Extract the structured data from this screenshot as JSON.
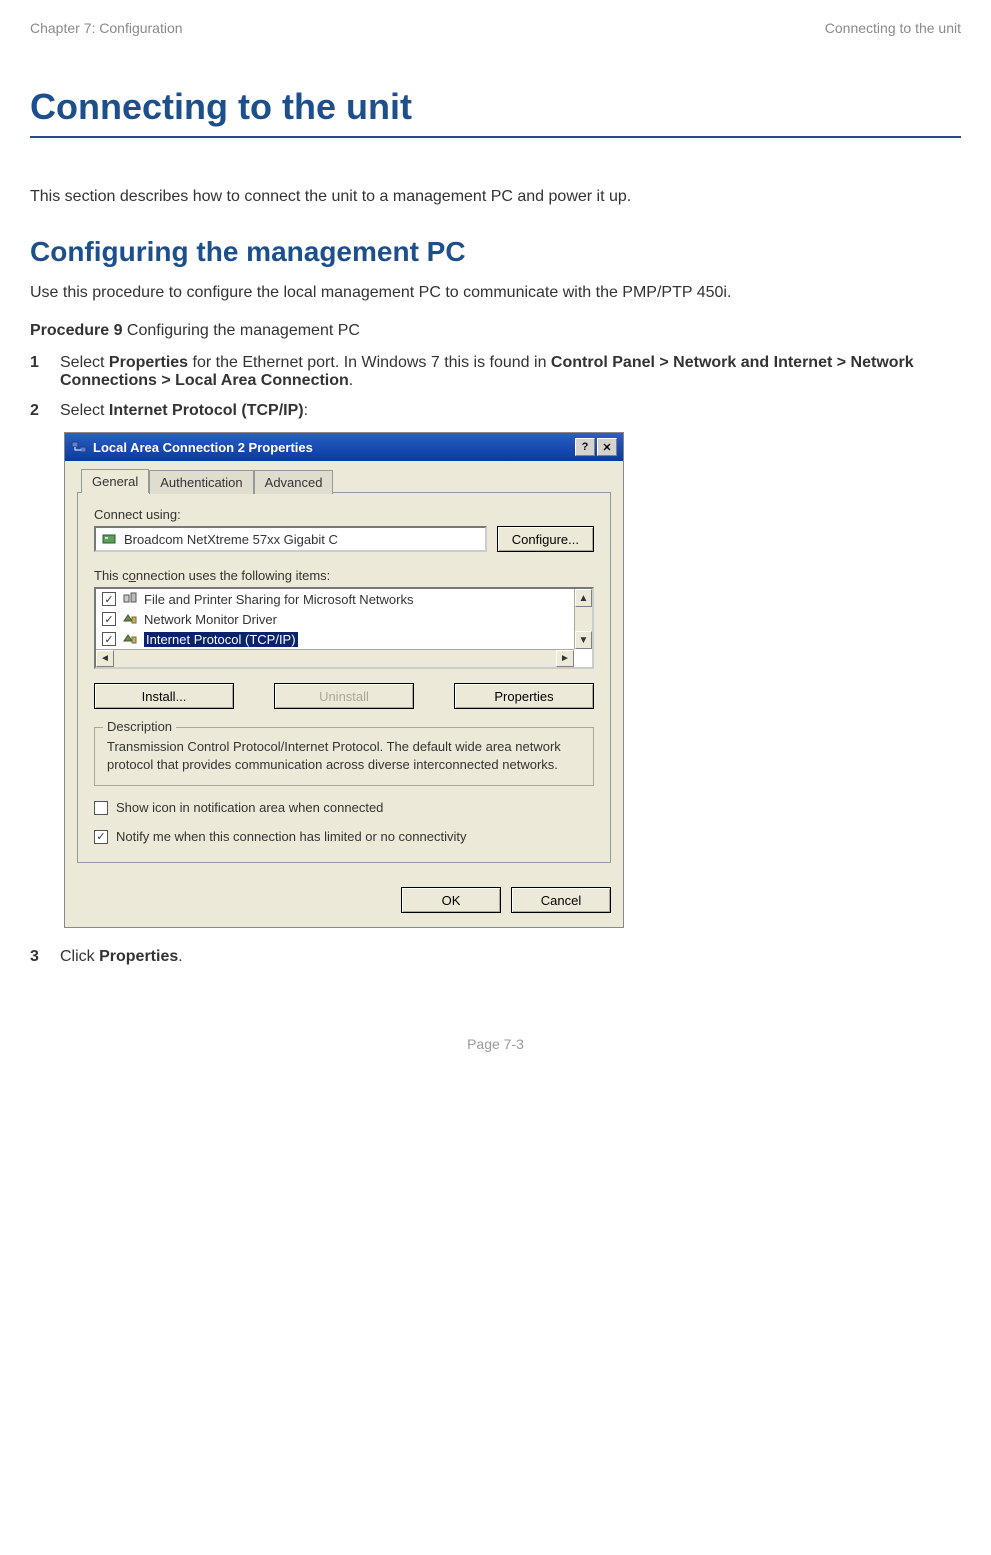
{
  "header": {
    "left": "Chapter 7:  Configuration",
    "right": "Connecting to the unit"
  },
  "title": "Connecting to the unit",
  "intro": "This section describes how to connect the unit to a management PC and power it up.",
  "subhead": "Configuring the management PC",
  "body1": "Use this procedure to configure the local management PC to communicate with the PMP/PTP 450i.",
  "procedure_label": "Procedure 9",
  "procedure_title": "  Configuring the management PC",
  "steps": {
    "s1": {
      "num": "1",
      "t1": "Select ",
      "b1": "Properties",
      "t2": " for the Ethernet port. In Windows 7 this is found in ",
      "b2": "Control Panel > Network and Internet > Network Connections > Local Area Connection",
      "t3": "."
    },
    "s2": {
      "num": "2",
      "t1": "Select ",
      "b1": "Internet Protocol (TCP/IP)",
      "t2": ":"
    },
    "s3": {
      "num": "3",
      "t1": "Click ",
      "b1": "Properties",
      "t2": "."
    }
  },
  "dialog": {
    "title": "Local Area Connection 2 Properties",
    "help_btn": "?",
    "close_btn": "✕",
    "tabs": {
      "general": "General",
      "auth": "Authentication",
      "adv": "Advanced"
    },
    "connect_label_pre": "Connect usin",
    "connect_label_ul": "g",
    "connect_label_post": ":",
    "adapter": "Broadcom NetXtreme 57xx Gigabit C",
    "configure_btn": "Configure...",
    "items_label_pre": "This c",
    "items_label_ul": "o",
    "items_label_post": "nnection uses the following items:",
    "items": {
      "i0": "File and Printer Sharing for Microsoft Networks",
      "i1": "Network Monitor Driver",
      "i2": "Internet Protocol (TCP/IP)"
    },
    "install_btn": "Install...",
    "uninstall_btn": "Uninstall",
    "properties_btn": "Properties",
    "desc_legend": "Description",
    "desc_text": "Transmission Control Protocol/Internet Protocol. The default wide area network protocol that provides communication across diverse interconnected networks.",
    "show_icon_pre": "Sho",
    "show_icon_ul": "w",
    "show_icon_post": " icon in notification area when connected",
    "notify_pre": "Notify ",
    "notify_ul": "m",
    "notify_post": "e when this connection has limited or no connectivity",
    "ok_btn": "OK",
    "cancel_btn": "Cancel"
  },
  "footer": "Page 7-3"
}
